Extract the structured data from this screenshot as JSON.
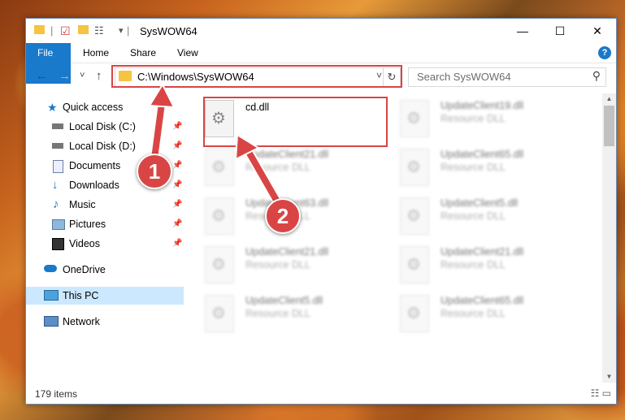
{
  "window": {
    "title": "SysWOW64",
    "controls": {
      "minimize": "—",
      "maximize": "☐",
      "close": "✕"
    }
  },
  "ribbon": {
    "tabs": [
      "File",
      "Home",
      "Share",
      "View"
    ],
    "help": "?"
  },
  "nav": {
    "back": "←",
    "forward": "→",
    "recent": "˅",
    "up": "↑",
    "address_path": "C:\\Windows\\SysWOW64",
    "address_dropdown": "˅",
    "refresh": "↻",
    "search_placeholder": "Search SysWOW64",
    "search_icon": "⚲"
  },
  "sidebar": {
    "items": [
      {
        "label": "Quick access",
        "icon": "star-icon",
        "pinned": false
      },
      {
        "label": "Local Disk (C:)",
        "icon": "drive-icon",
        "pinned": true
      },
      {
        "label": "Local Disk (D:)",
        "icon": "drive-icon",
        "pinned": true
      },
      {
        "label": "Documents",
        "icon": "documents-icon",
        "pinned": true
      },
      {
        "label": "Downloads",
        "icon": "download-icon",
        "pinned": true
      },
      {
        "label": "Music",
        "icon": "music-icon",
        "pinned": true
      },
      {
        "label": "Pictures",
        "icon": "pictures-icon",
        "pinned": true
      },
      {
        "label": "Videos",
        "icon": "videos-icon",
        "pinned": true
      },
      {
        "label": "OneDrive",
        "icon": "cloud-icon",
        "pinned": false
      },
      {
        "label": "This PC",
        "icon": "computer-icon",
        "pinned": false,
        "selected": true
      },
      {
        "label": "Network",
        "icon": "network-icon",
        "pinned": false
      }
    ],
    "pin_glyph": "📌"
  },
  "files": [
    {
      "name": "cd.dll",
      "type": ""
    },
    {
      "name": "UpdateClient19.dll",
      "type": "Resource DLL"
    },
    {
      "name": "UpdateClient21.dll",
      "type": "Resource DLL"
    },
    {
      "name": "UpdateClient65.dll",
      "type": "Resource DLL"
    },
    {
      "name": "UpdateClient63.dll",
      "type": "Resource DLL"
    },
    {
      "name": "UpdateClient5.dll",
      "type": "Resource DLL"
    },
    {
      "name": "UpdateClient21.dll",
      "type": "Resource DLL"
    },
    {
      "name": "UpdateClient21.dll",
      "type": "Resource DLL"
    },
    {
      "name": "UpdateClient5.dll",
      "type": "Resource DLL"
    },
    {
      "name": "UpdateClient65.dll",
      "type": "Resource DLL"
    }
  ],
  "status": {
    "item_count": "179 items",
    "view_icons": "☷ ▭"
  },
  "callouts": [
    "1",
    "2"
  ],
  "colors": {
    "accent": "#1979ca",
    "highlight": "#d94545",
    "selected": "#cce8ff"
  }
}
